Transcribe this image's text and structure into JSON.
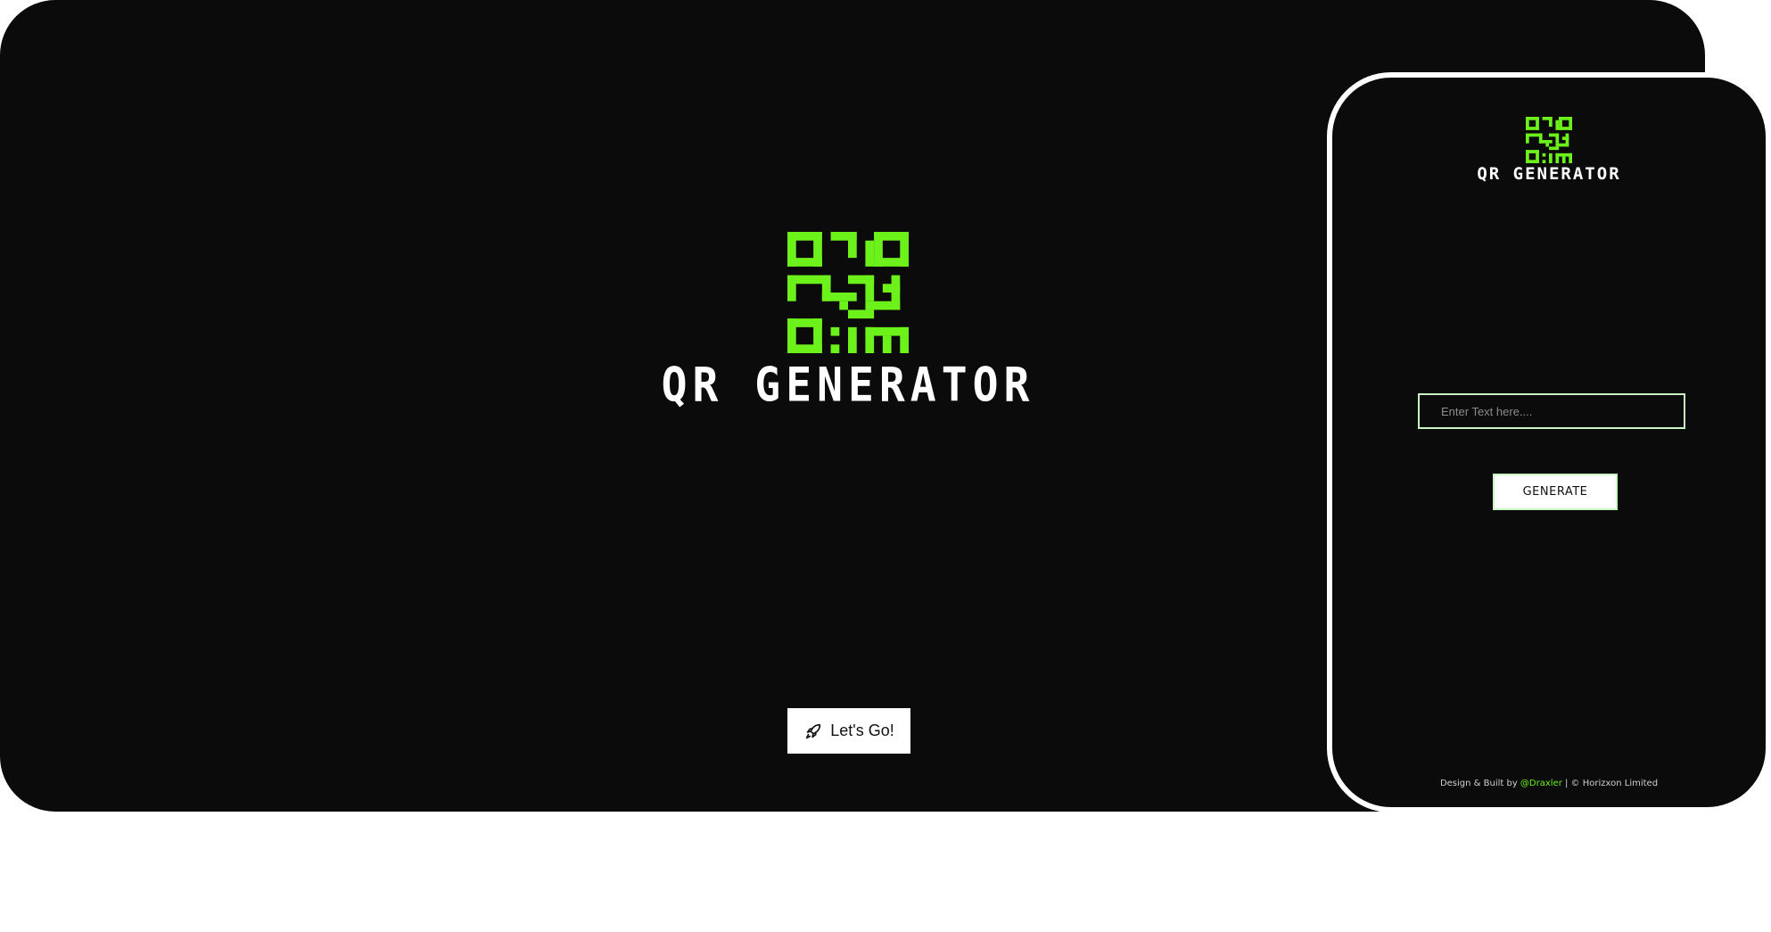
{
  "brand": {
    "title": "QR GENERATOR",
    "accent_color": "#6cf21a",
    "logo_icon": "qr-code-icon"
  },
  "desktop": {
    "cta_label": "Let's Go!",
    "cta_icon": "rocket-icon"
  },
  "mobile": {
    "title": "QR GENERATOR",
    "input_placeholder": "Enter Text here....",
    "input_value": "",
    "generate_label": "GENERATE",
    "footer": {
      "prefix": "Design & Built by ",
      "author": "@Draxler",
      "suffix": " | © Horizxon Limited"
    }
  }
}
